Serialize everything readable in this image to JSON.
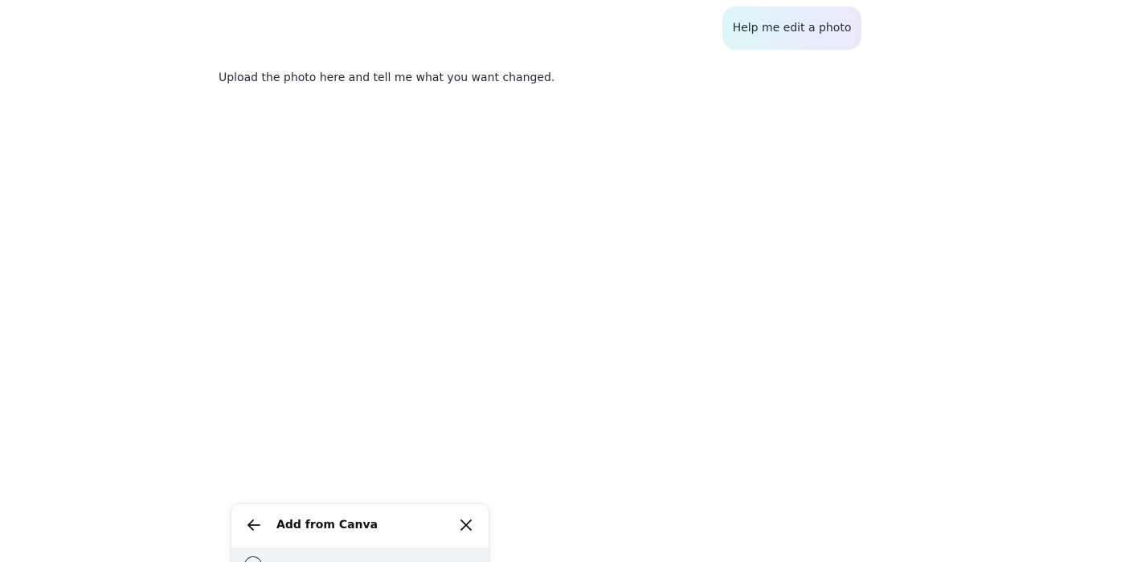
{
  "chat": {
    "user_message": "Help me edit a photo",
    "assistant_message": "Upload the photo here and tell me what you want changed."
  },
  "popover": {
    "title": "Add from Canva",
    "back_icon": "arrow-left-icon",
    "close_icon": "close-icon",
    "rows": [
      {
        "icon": "circle-icon",
        "label": ""
      }
    ]
  },
  "colors": {
    "background": "#ffffff",
    "user_bubble_start": "#ddf6f9",
    "user_bubble_end": "#ece8fb",
    "text": "#1f2937",
    "row_highlight": "#f2f3f5"
  }
}
